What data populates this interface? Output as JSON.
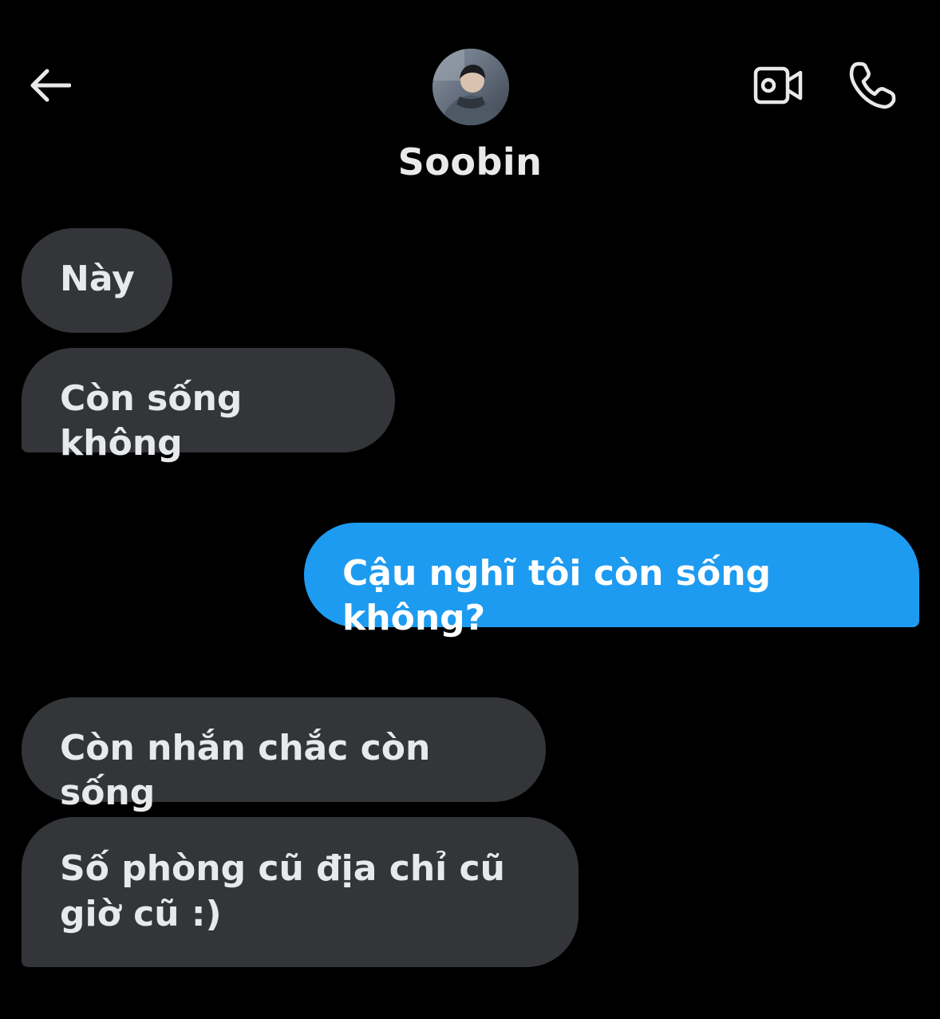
{
  "header": {
    "back_icon": "arrow-left-icon",
    "contact_name": "Soobin",
    "video_icon": "video-camera-icon",
    "call_icon": "phone-icon"
  },
  "messages": [
    {
      "direction": "incoming",
      "text": "Này"
    },
    {
      "direction": "incoming",
      "text": "Còn sống không"
    },
    {
      "direction": "outgoing",
      "text": "Cậu nghĩ tôi còn sống không?"
    },
    {
      "direction": "incoming",
      "text": "Còn nhắn chắc còn sống"
    },
    {
      "direction": "incoming",
      "text": "Số phòng cũ địa chỉ cũ giờ cũ :)"
    }
  ],
  "colors": {
    "background": "#000000",
    "incoming_bubble": "#333539",
    "outgoing_bubble": "#1d9bf0",
    "text": "#e7e9ea"
  }
}
